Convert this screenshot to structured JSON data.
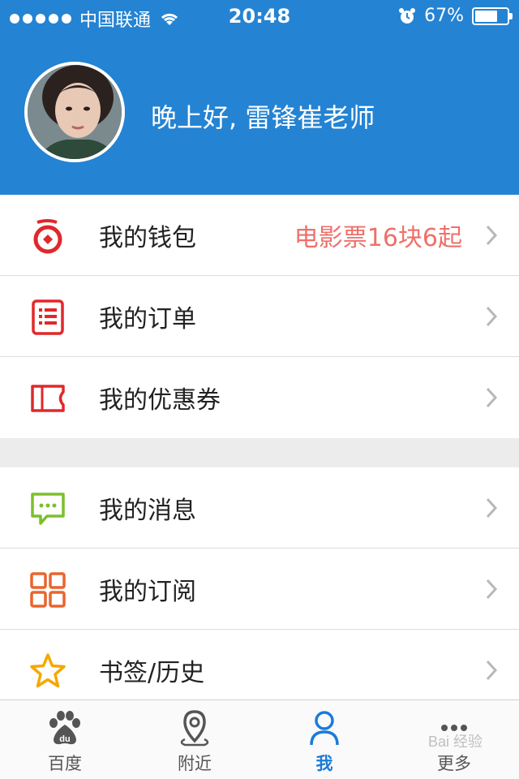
{
  "status_bar": {
    "carrier": "中国联通",
    "time": "20:48",
    "battery": "67%",
    "battery_level": 0.67
  },
  "header": {
    "greeting": "晚上好, 雷锋崔老师",
    "color": "#2483d3"
  },
  "group1": [
    {
      "label": "我的钱包",
      "value": "电影票16块6起",
      "icon": "wallet-icon"
    },
    {
      "label": "我的订单",
      "value": "",
      "icon": "order-list-icon"
    },
    {
      "label": "我的优惠券",
      "value": "",
      "icon": "coupon-icon"
    }
  ],
  "group2": [
    {
      "label": "我的消息",
      "value": "",
      "icon": "message-icon"
    },
    {
      "label": "我的订阅",
      "value": "",
      "icon": "subscribe-grid-icon"
    },
    {
      "label": "书签/历史",
      "value": "",
      "icon": "star-icon"
    }
  ],
  "tabs": [
    {
      "label": "百度",
      "icon": "baidu-paw-icon"
    },
    {
      "label": "附近",
      "icon": "location-pin-icon"
    },
    {
      "label": "我",
      "icon": "person-icon",
      "active": true
    },
    {
      "label": "更多",
      "icon": "more-dots-icon"
    }
  ],
  "watermark": "Bai 经验",
  "colors": {
    "accent": "#1a7bd8",
    "promo": "#ee7069",
    "red_icon": "#e0282b",
    "green_icon": "#7cc02b",
    "orange_icon": "#e9652d",
    "yellow_icon": "#f5a800"
  }
}
